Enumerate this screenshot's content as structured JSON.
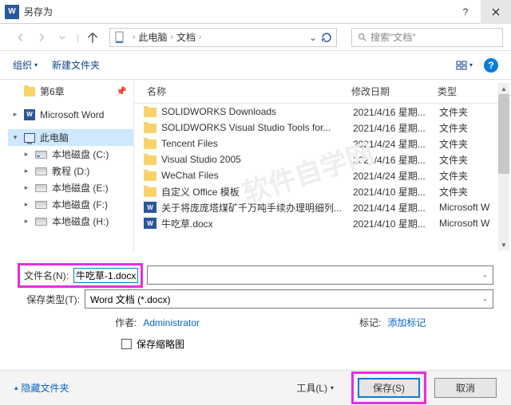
{
  "title": "另存为",
  "breadcrumb": {
    "p1": "此电脑",
    "p2": "文档"
  },
  "search": {
    "placeholder": "搜索\"文档\""
  },
  "toolbar": {
    "organize": "组织",
    "newFolder": "新建文件夹"
  },
  "sidebar": {
    "root": "第6章",
    "word": "Microsoft Word",
    "pc": "此电脑",
    "drives": [
      {
        "label": "本地磁盘 (C:)"
      },
      {
        "label": "教程 (D:)"
      },
      {
        "label": "本地磁盘 (E:)"
      },
      {
        "label": "本地磁盘 (F:)"
      },
      {
        "label": "本地磁盘 (H:)"
      }
    ]
  },
  "columns": {
    "name": "名称",
    "date": "修改日期",
    "type": "类型"
  },
  "files": [
    {
      "icon": "folder",
      "name": "SOLIDWORKS Downloads",
      "date": "2021/4/16 星期...",
      "type": "文件夹"
    },
    {
      "icon": "folder",
      "name": "SOLIDWORKS Visual Studio Tools for...",
      "date": "2021/4/16 星期...",
      "type": "文件夹"
    },
    {
      "icon": "folder",
      "name": "Tencent Files",
      "date": "2021/4/24 星期...",
      "type": "文件夹"
    },
    {
      "icon": "folder",
      "name": "Visual Studio 2005",
      "date": "2021/4/16 星期...",
      "type": "文件夹"
    },
    {
      "icon": "folder",
      "name": "WeChat Files",
      "date": "2021/4/24 星期...",
      "type": "文件夹"
    },
    {
      "icon": "folder",
      "name": "自定义 Office 模板",
      "date": "2021/4/10 星期...",
      "type": "文件夹"
    },
    {
      "icon": "word",
      "name": "关于将庞庞塔煤矿千万吨手续办理明细列...",
      "date": "2021/4/14 星期...",
      "type": "Microsoft W"
    },
    {
      "icon": "word",
      "name": "牛吃草.docx",
      "date": "2021/4/10 星期...",
      "type": "Microsoft W"
    }
  ],
  "form": {
    "fileNameLabel": "文件名(N):",
    "fileName": "牛吃草-1.docx",
    "saveTypeLabel": "保存类型(T):",
    "saveType": "Word 文档 (*.docx)",
    "authorLabel": "作者:",
    "author": "Administrator",
    "tagLabel": "标记:",
    "tagValue": "添加标记",
    "thumbLabel": "保存缩略图"
  },
  "bottom": {
    "hideFolders": "隐藏文件夹",
    "tools": "工具(L)",
    "save": "保存(S)",
    "cancel": "取消"
  }
}
